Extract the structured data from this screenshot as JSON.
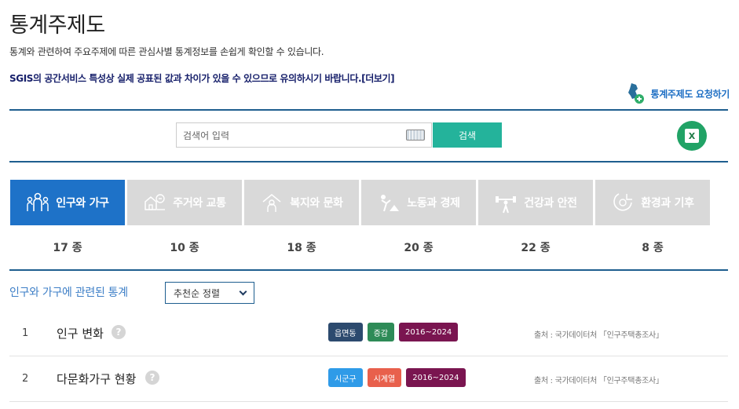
{
  "page_title": "통계주제도",
  "description": "통계와 관련하여 주요주제에 따른 관심사별 통계정보를 손쉽게 확인할 수 있습니다.",
  "notice": "SGIS의 공간서비스 특성상 실제 공표된 값과 차이가 있을 수 있으므로 유의하시기 바랍니다.[더보기]",
  "request_link": "통계주제도 요청하기",
  "search": {
    "placeholder": "검색어 입력",
    "button": "검색"
  },
  "excel_icon_text": "X",
  "tabs": [
    {
      "label": "인구와 가구",
      "count": "17 종",
      "icon": "people-icon",
      "active": true
    },
    {
      "label": "주거와 교통",
      "count": "10 종",
      "icon": "house-car-icon",
      "active": false
    },
    {
      "label": "복지와 문화",
      "count": "18 종",
      "icon": "welfare-icon",
      "active": false
    },
    {
      "label": "노동과 경제",
      "count": "20 종",
      "icon": "labor-icon",
      "active": false
    },
    {
      "label": "건강과 안전",
      "count": "22 종",
      "icon": "health-icon",
      "active": false
    },
    {
      "label": "환경과 기후",
      "count": "8 종",
      "icon": "environment-icon",
      "active": false
    }
  ],
  "list_heading": "인구와 가구에 관련된 통계",
  "sort": {
    "selected": "추천순 정렬"
  },
  "rows": [
    {
      "num": "1",
      "name": "인구 변화",
      "help": "?",
      "badges": [
        {
          "text": "읍면동",
          "color": "#2c4a6e"
        },
        {
          "text": "증감",
          "color": "#2e8b57"
        },
        {
          "text": "2016~2024",
          "color": "#7a1550"
        }
      ],
      "source": "출처 : 국가데이터처 「인구주택총조사」"
    },
    {
      "num": "2",
      "name": "다문화가구 현황",
      "help": "?",
      "badges": [
        {
          "text": "시군구",
          "color": "#2f9be8"
        },
        {
          "text": "시계열",
          "color": "#e8604c"
        },
        {
          "text": "2016~2024",
          "color": "#7a1550"
        }
      ],
      "source": "출처 : 국가데이터처 「인구주택총조사」"
    }
  ]
}
